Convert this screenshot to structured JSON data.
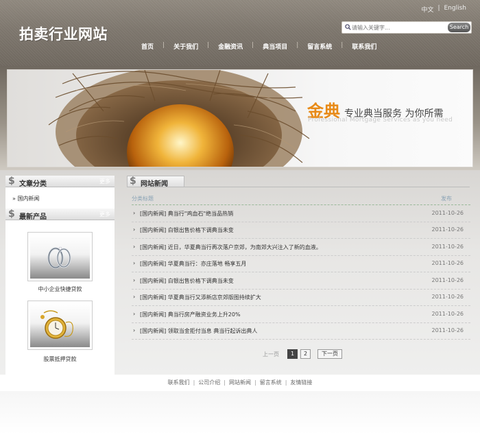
{
  "header": {
    "logo": "拍卖行业网站",
    "lang": {
      "zh": "中文",
      "sep": "|",
      "en": "English"
    },
    "search": {
      "placeholder": "请输入关键字...",
      "button": "Search"
    },
    "nav": [
      "首页",
      "关于我们",
      "金融资讯",
      "典当项目",
      "留言系统",
      "联系我们"
    ]
  },
  "banner": {
    "title_highlight": "金典",
    "title_rest": "专业典当服务  为你所需",
    "subtitle": "Professional Mortgage Services as you need"
  },
  "sidebar": {
    "categories_title": "文章分类",
    "categories_more": "更多",
    "category_items": [
      "国内新闻"
    ],
    "products_title": "最新产品",
    "products_more": "更多",
    "products": [
      {
        "caption": "中小企业快捷贷款",
        "icon": "rings-icon"
      },
      {
        "caption": "股票抵押贷款",
        "icon": "pocket-watch-icon"
      }
    ]
  },
  "news": {
    "title": "网站新闻",
    "col_title": "分类标题",
    "col_date": "发布",
    "rows": [
      {
        "category": "[国内新闻]",
        "title": "典当行\"鸡血石\"绝当品热销",
        "date": "2011-10-26"
      },
      {
        "category": "[国内新闻]",
        "title": "白银出售价格下调典当未变",
        "date": "2011-10-26"
      },
      {
        "category": "[国内新闻]",
        "title": "近日，华夏典当行再次落户京郊，为南郊大兴注入了新的血液。",
        "date": "2011-10-26"
      },
      {
        "category": "[国内新闻]",
        "title": "华夏典当行：亦庄落地 畅享五月",
        "date": "2011-10-26"
      },
      {
        "category": "[国内新闻]",
        "title": "白银出售价格下调典当未变",
        "date": "2011-10-26"
      },
      {
        "category": "[国内新闻]",
        "title": "华夏典当行又添新店京郊版图持续扩大",
        "date": "2011-10-26"
      },
      {
        "category": "[国内新闻]",
        "title": "典当行房产融资业务上升20%",
        "date": "2011-10-26"
      },
      {
        "category": "[国内新闻]",
        "title": "领取当金拒付当息 典当行起诉出典人",
        "date": "2011-10-26"
      }
    ],
    "pager": {
      "prev": "上一页",
      "pages": [
        "1",
        "2"
      ],
      "active": "1",
      "next": "下一页"
    }
  },
  "footer": {
    "links": [
      "联系我们",
      "公司介绍",
      "网站新闻",
      "留言系统",
      "友情链接"
    ]
  }
}
